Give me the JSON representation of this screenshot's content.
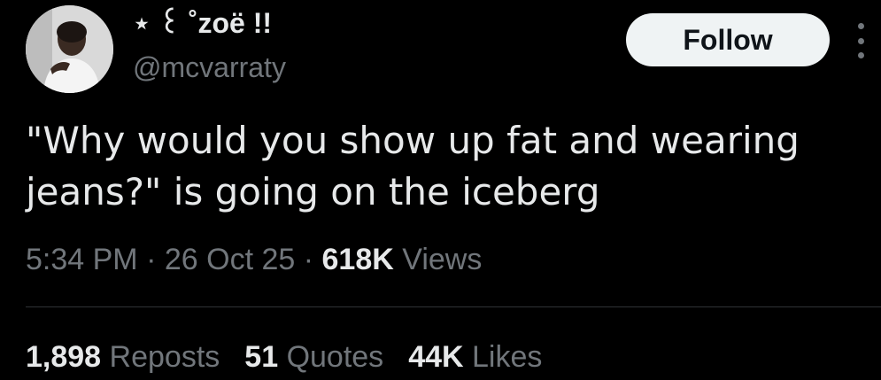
{
  "author": {
    "display_name": "⋆ ꒰ ˚zoë !!",
    "handle": "@mcvarraty",
    "avatar_icon": "user-avatar-photo"
  },
  "follow_label": "Follow",
  "more_icon": "more-options-icon",
  "tweet_text": "\"Why would you show up fat and wearing jeans?\" is going on the iceberg",
  "meta": {
    "time": "5:34 PM",
    "sep1": "·",
    "date": "26 Oct 25",
    "sep2": "·",
    "views_count": "618K",
    "views_label": "Views"
  },
  "stats": {
    "reposts_count": "1,898",
    "reposts_label": "Reposts",
    "quotes_count": "51",
    "quotes_label": "Quotes",
    "likes_count": "44K",
    "likes_label": "Likes"
  },
  "colors": {
    "background": "#000000",
    "primary_text": "#e7e9ea",
    "secondary_text": "#71767b",
    "follow_bg": "#eff3f4",
    "divider": "#2f3336"
  }
}
